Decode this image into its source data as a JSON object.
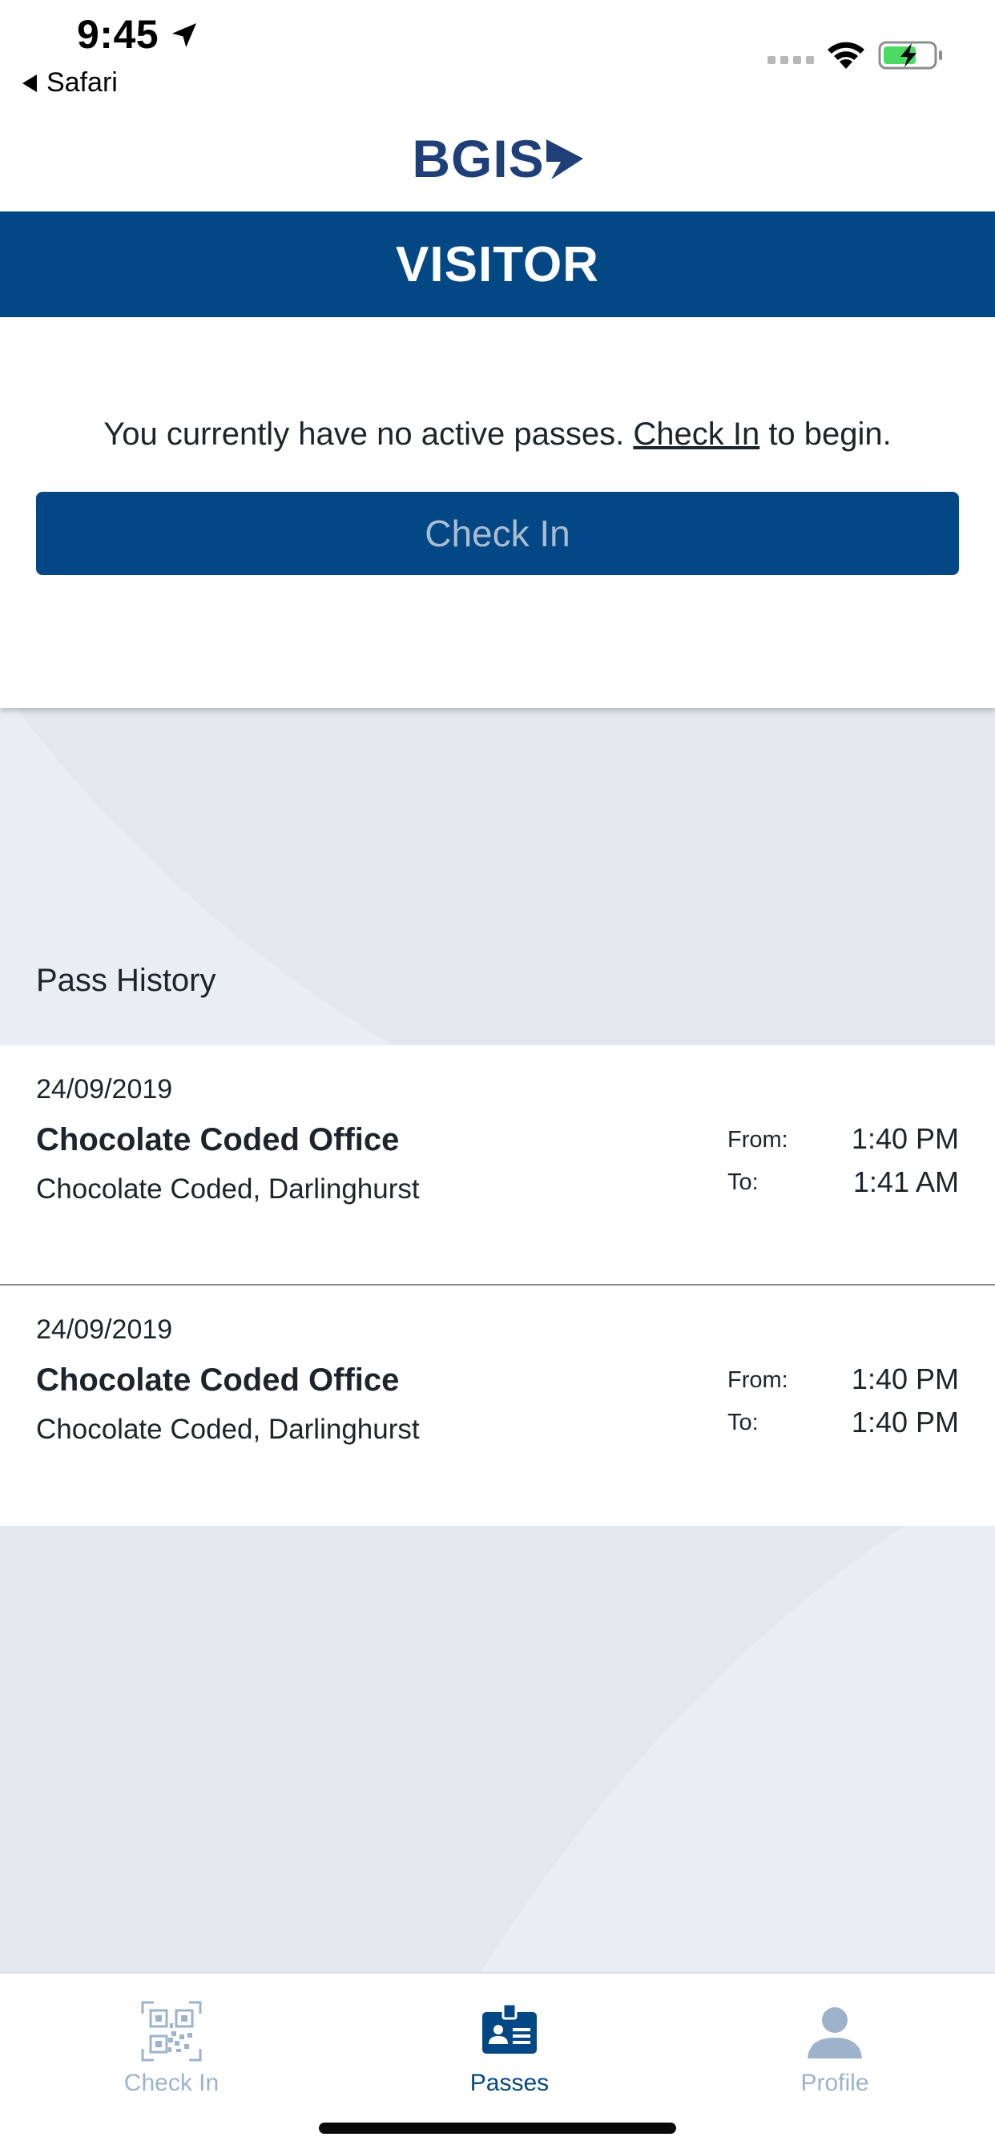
{
  "status_bar": {
    "time": "9:45",
    "back_label": "Safari",
    "location_icon": "location-arrow-icon",
    "wifi_icon": "wifi-icon",
    "battery_icon": "battery-charging-icon"
  },
  "header": {
    "logo_text": "BGIS",
    "banner_title": "VISITOR"
  },
  "active_pass": {
    "message_prefix": "You currently have no active passes. ",
    "message_link": "Check In",
    "message_suffix": " to begin.",
    "button_label": "Check In"
  },
  "history": {
    "title": "Pass History",
    "items": [
      {
        "date": "24/09/2019",
        "name": "Chocolate Coded Office",
        "location": "Chocolate Coded, Darlinghurst",
        "from_label": "From:",
        "from_time": "1:40 PM",
        "to_label": "To:",
        "to_time": "1:41 AM"
      },
      {
        "date": "24/09/2019",
        "name": "Chocolate Coded Office",
        "location": "Chocolate Coded, Darlinghurst",
        "from_label": "From:",
        "from_time": "1:40 PM",
        "to_label": "To:",
        "to_time": "1:40 PM"
      }
    ]
  },
  "tabs": [
    {
      "label": "Check In",
      "icon": "qr-code-icon",
      "active": false
    },
    {
      "label": "Passes",
      "icon": "id-badge-icon",
      "active": true
    },
    {
      "label": "Profile",
      "icon": "user-icon",
      "active": false
    }
  ],
  "colors": {
    "brand_blue": "#034884",
    "logo_blue": "#1f3f78",
    "inactive_tab": "#9db3cc",
    "history_bg": "#e3e7ee"
  }
}
